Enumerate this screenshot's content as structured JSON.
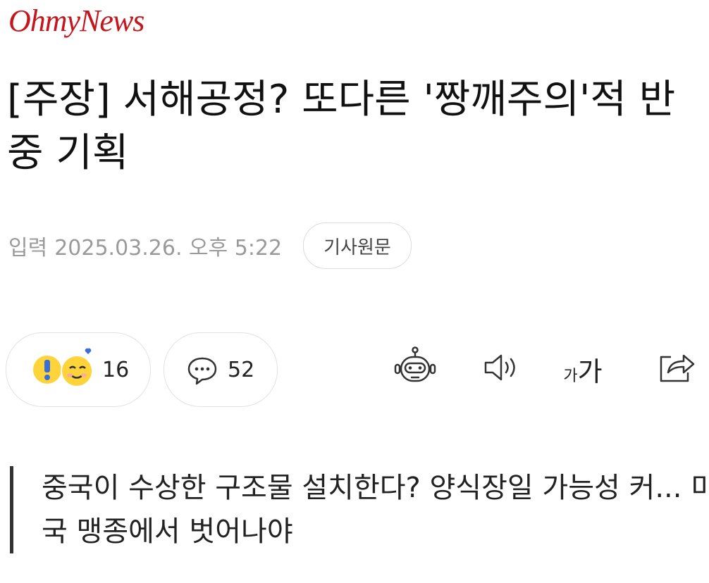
{
  "site": {
    "logo_text": "OhmyNews"
  },
  "article": {
    "headline": "[주장] 서해공정? 또다른 '짱깨주의'적 반중 기획",
    "published_label": "입력",
    "published_datetime": "2025.03.26. 오후 5:22",
    "original_link_label": "기사원문",
    "subheadline": "중국이 수상한 구조물 설치한다? 양식장일 가능성 커... 미국 맹종에서 벗어나야"
  },
  "actions": {
    "reaction_count": "16",
    "comment_count": "52",
    "font_size_small": "가",
    "font_size_large": "가"
  },
  "icons": {
    "reactions": "reaction-emoji-icon",
    "comments": "speech-bubble-icon",
    "summary_bot": "robot-icon",
    "audio": "speaker-icon",
    "font_size": "font-size-icon",
    "share": "share-icon"
  },
  "colors": {
    "brand": "#c4161c",
    "meta_text": "#9a9a9a",
    "border": "#e2e2e2"
  }
}
